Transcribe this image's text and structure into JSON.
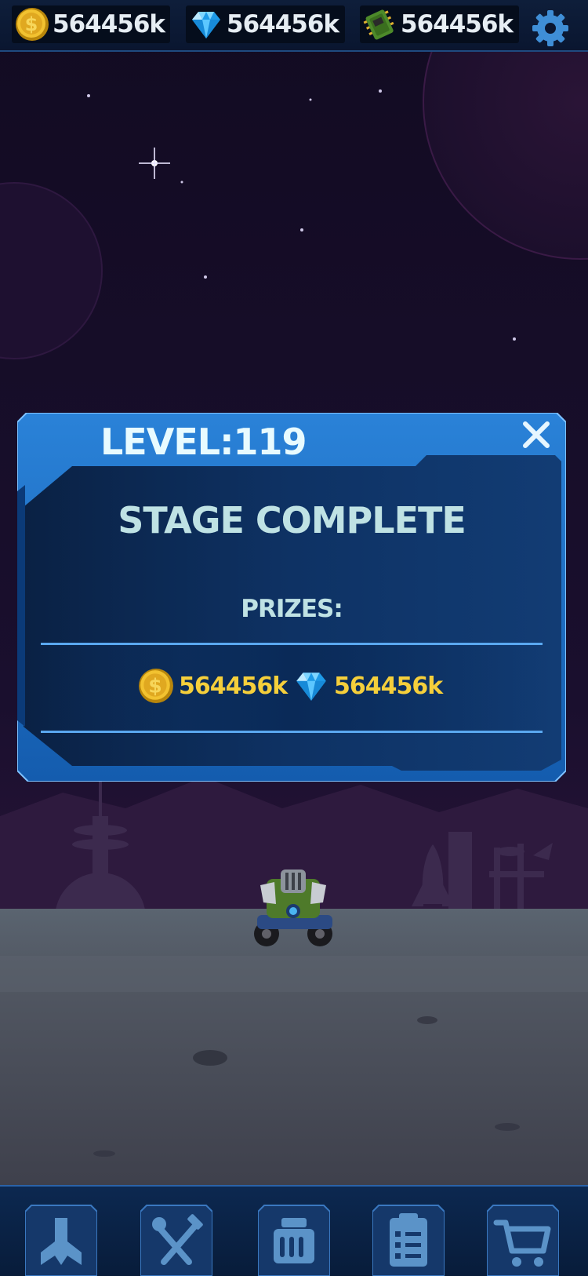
{
  "currencies": {
    "coins": {
      "icon": "coin-icon",
      "value": "564456k"
    },
    "gems": {
      "icon": "gem-icon",
      "value": "564456k"
    },
    "chips": {
      "icon": "chip-icon",
      "value": "564456k"
    }
  },
  "settings_icon": "gear-icon",
  "dialog": {
    "level": "LEVEL:119",
    "close_icon": "close-icon",
    "title": "STAGE COMPLETE",
    "prizes_label": "PRIZES:",
    "prizes": [
      {
        "icon": "coin-icon",
        "value": "564456k"
      },
      {
        "icon": "gem-icon",
        "value": "564456k"
      }
    ]
  },
  "nav": [
    {
      "icon": "hangar-icon"
    },
    {
      "icon": "tools-icon"
    },
    {
      "icon": "ammo-icon"
    },
    {
      "icon": "clipboard-icon"
    },
    {
      "icon": "cart-icon"
    }
  ],
  "colors": {
    "sky": "#140c24",
    "panel": "#1565b8",
    "panel_inner": "#0c2c58",
    "prize_text": "#f5cf3b",
    "ground": "#4a4f5c"
  }
}
